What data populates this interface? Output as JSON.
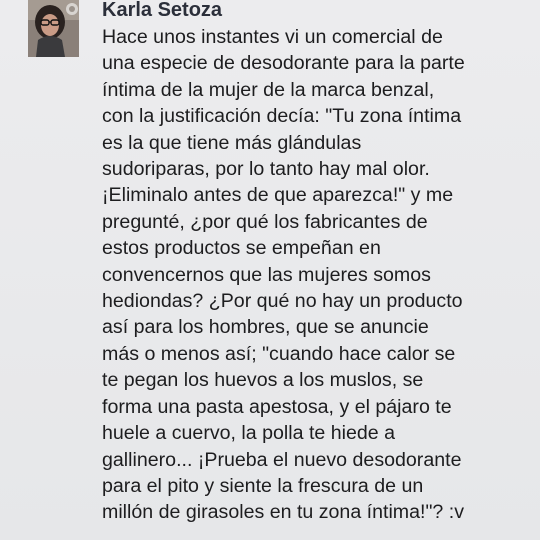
{
  "post": {
    "author": "Karla Setoza",
    "lines": [
      "Hace unos instantes vi un comercial de",
      "una especie de desodorante para la parte",
      "íntima de la mujer de la marca benzal,",
      "con la justificación decía: \"Tu zona íntima",
      "es la que tiene más glándulas",
      "sudoriparas,  por lo tanto hay mal olor.",
      "¡Eliminalo antes de que aparezca!\" y me",
      "pregunté, ¿por qué los fabricantes de",
      "estos productos se empeñan en",
      "convencernos que las mujeres somos",
      "hediondas? ¿Por qué no hay un producto",
      "así para los hombres,  que se anuncie",
      "más o menos así; \"cuando hace calor se",
      "te pegan los huevos a los muslos,  se",
      "forma una pasta apestosa,  y el pájaro te",
      "huele a cuervo, la polla te hiede a",
      "gallinero... ¡Prueba el nuevo desodorante",
      "para el pito y siente la frescura de un",
      "millón de girasoles en tu zona íntima!\"?  :v"
    ]
  }
}
